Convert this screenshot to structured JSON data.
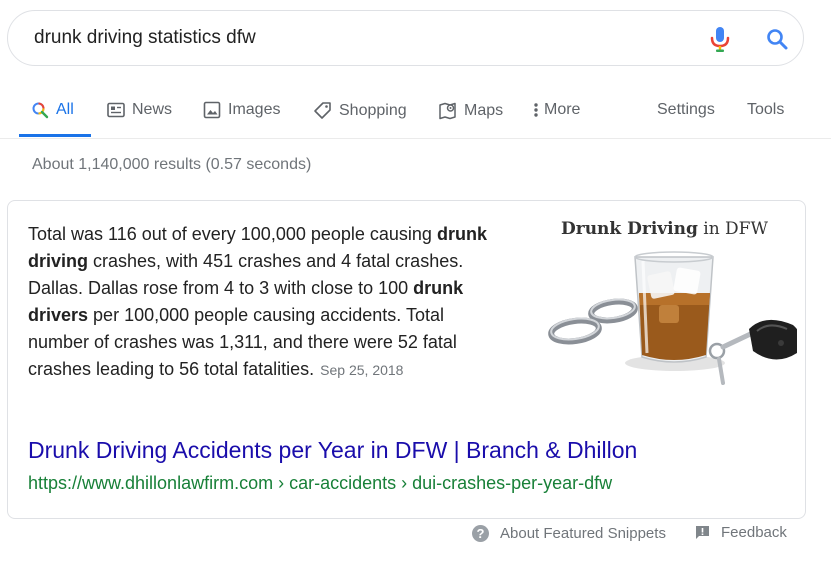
{
  "search": {
    "query": "drunk driving statistics dfw"
  },
  "tabs": [
    {
      "label": "All",
      "icon": "search-icon"
    },
    {
      "label": "News",
      "icon": "news-icon"
    },
    {
      "label": "Images",
      "icon": "image-icon"
    },
    {
      "label": "Shopping",
      "icon": "tag-icon"
    },
    {
      "label": "Maps",
      "icon": "map-icon"
    },
    {
      "label": "More",
      "icon": "more-vert-icon"
    }
  ],
  "tools": {
    "settings": "Settings",
    "tools": "Tools"
  },
  "result_stats": "About 1,140,000 results (0.57 seconds)",
  "snippet": {
    "t1": "Total was 116 out of every 100,000 people causing ",
    "b1": "drunk driving",
    "t2": " crashes, with 451 crashes and 4 fatal crashes. Dallas. Dallas rose from 4 to 3 with close to 100 ",
    "b2": "drunk drivers",
    "t3": " per 100,000 people causing accidents. Total number of crashes was 1,311, and there were 52 fatal crashes leading to 56 total fatalities.",
    "date": "Sep 25, 2018",
    "image_title_bold": "Drunk Driving",
    "image_title_rest": " in DFW"
  },
  "result": {
    "title": "Drunk Driving Accidents per Year in DFW | Branch & Dhillon",
    "url": "https://www.dhillonlawfirm.com › car-accidents › dui-crashes-per-year-dfw"
  },
  "footer": {
    "about": "About Featured Snippets",
    "feedback": "Feedback"
  },
  "colors": {
    "accent": "#1a73e8",
    "link": "#1a0dab",
    "url": "#188038",
    "muted": "#70757a"
  }
}
